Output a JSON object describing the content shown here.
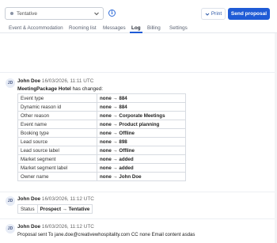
{
  "header": {
    "status_value": "Tentative",
    "info_icon": "info-icon",
    "print_label": "Print",
    "send_label": "Send proposal"
  },
  "tabs": [
    {
      "label": "Event & Accommodation",
      "active": false
    },
    {
      "label": "Rooming list",
      "active": false
    },
    {
      "label": "Messages",
      "active": false
    },
    {
      "label": "Log",
      "active": true
    },
    {
      "label": "Billing",
      "active": false
    },
    {
      "label": "Settings",
      "active": false
    }
  ],
  "log": [
    {
      "initials": "JD",
      "author": "John Doe",
      "timestamp": "16/03/2026, 11:11 UTC",
      "subject": "MeetingPackage Hotel",
      "subject_suffix": "has changed:",
      "changes": [
        {
          "field": "Event type",
          "value": "none → 884"
        },
        {
          "field": "Dynamic reason id",
          "value": "none → 884"
        },
        {
          "field": "Other reason",
          "value": "none → Corporate Meetings"
        },
        {
          "field": "Event name",
          "value": "none → Product planning"
        },
        {
          "field": "Booking type",
          "value": "none → Offline"
        },
        {
          "field": "Lead source",
          "value": "none → 898"
        },
        {
          "field": "Lead source label",
          "value": "none → Offline"
        },
        {
          "field": "Market segment",
          "value": "none → added"
        },
        {
          "field": "Market segment label",
          "value": "none → added"
        },
        {
          "field": "Owner name",
          "value": "none → John Doe"
        }
      ]
    },
    {
      "initials": "JD",
      "author": "John Doe",
      "timestamp": "16/03/2026, 11:12 UTC",
      "changes": [
        {
          "field": "Status",
          "value": "Prospect → Tentative"
        }
      ]
    },
    {
      "initials": "JD",
      "author": "John Doe",
      "timestamp": "16/03/2026, 11:12 UTC",
      "message": "Proposal sent To jane.doe@creativewhospitality.com CC none Email content asdas"
    }
  ]
}
